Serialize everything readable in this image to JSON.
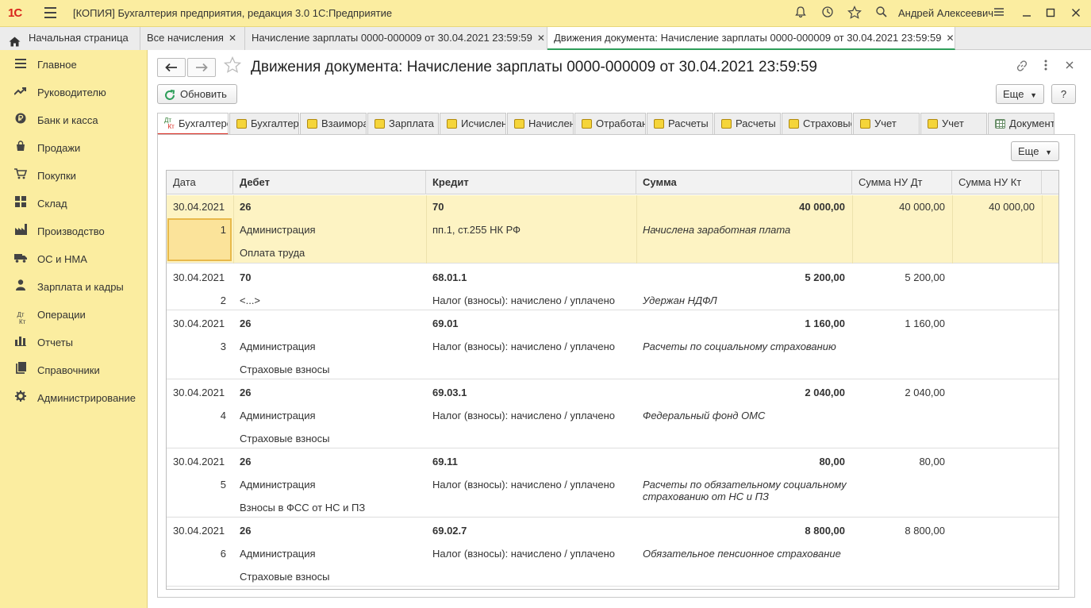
{
  "titlebar": {
    "logo": "1С",
    "title": "[КОПИЯ] Бухгалтерия предприятия, редакция 3.0 1С:Предприятие",
    "user": "Андрей Алексеевич"
  },
  "tabs": [
    {
      "label": "Начальная страница"
    },
    {
      "label": "Все начисления"
    },
    {
      "label": "Начисление зарплаты 0000-000009 от 30.04.2021 23:59:59"
    },
    {
      "label": "Движения документа: Начисление зарплаты 0000-000009 от 30.04.2021 23:59:59"
    }
  ],
  "sidebar": {
    "items": [
      {
        "label": "Главное",
        "icon": "menu-icon"
      },
      {
        "label": "Руководителю",
        "icon": "trend-icon"
      },
      {
        "label": "Банк и касса",
        "icon": "ruble-icon"
      },
      {
        "label": "Продажи",
        "icon": "bag-icon"
      },
      {
        "label": "Покупки",
        "icon": "cart-icon"
      },
      {
        "label": "Склад",
        "icon": "warehouse-icon"
      },
      {
        "label": "Производство",
        "icon": "factory-icon"
      },
      {
        "label": "ОС и НМА",
        "icon": "truck-icon"
      },
      {
        "label": "Зарплата и кадры",
        "icon": "person-icon"
      },
      {
        "label": "Операции",
        "icon": "dtkt-icon"
      },
      {
        "label": "Отчеты",
        "icon": "bar-chart-icon"
      },
      {
        "label": "Справочники",
        "icon": "book-icon"
      },
      {
        "label": "Администрирование",
        "icon": "gear-icon"
      }
    ]
  },
  "document": {
    "title": "Движения документа: Начисление зарплаты 0000-000009 от 30.04.2021 23:59:59",
    "refresh_label": "Обновить",
    "more_label": "Еще",
    "help_label": "?",
    "table_more_label": "Еще"
  },
  "subtabs": [
    {
      "label": "Бухгалтерский и налоговый учет"
    },
    {
      "label": "Бухгалтерский учет"
    },
    {
      "label": "Взаиморасчеты"
    },
    {
      "label": "Зарплата"
    },
    {
      "label": "Исчисленные налоги"
    },
    {
      "label": "Начисления"
    },
    {
      "label": "Отработанное время"
    },
    {
      "label": "Расчеты"
    },
    {
      "label": "Расчеты"
    },
    {
      "label": "Страховые взносы"
    },
    {
      "label": "Учет"
    },
    {
      "label": "Учет"
    },
    {
      "label": "Документ"
    }
  ],
  "table": {
    "headers": {
      "date": "Дата",
      "debit": "Дебет",
      "credit": "Кредит",
      "amount": "Сумма",
      "nu_dt": "Сумма НУ Дт",
      "nu_kt": "Сумма НУ Кт"
    },
    "rows": [
      {
        "date": "30.04.2021",
        "num": "1",
        "debit": "26",
        "debit_sub1": "Администрация",
        "debit_sub2": "Оплата труда",
        "credit": "70",
        "credit_sub1": "пп.1, ст.255 НК РФ",
        "amount": "40 000,00",
        "content": "Начислена заработная плата",
        "nu_dt": "40 000,00",
        "nu_kt": "40 000,00"
      },
      {
        "date": "30.04.2021",
        "num": "2",
        "debit": "70",
        "debit_sub1": "<...>",
        "debit_sub2": "",
        "credit": "68.01.1",
        "credit_sub1": "Налог (взносы): начислено / уплачено",
        "amount": "5 200,00",
        "content": "Удержан НДФЛ",
        "nu_dt": "5 200,00",
        "nu_kt": ""
      },
      {
        "date": "30.04.2021",
        "num": "3",
        "debit": "26",
        "debit_sub1": "Администрация",
        "debit_sub2": "Страховые взносы",
        "credit": "69.01",
        "credit_sub1": "Налог (взносы): начислено / уплачено",
        "amount": "1 160,00",
        "content": "Расчеты по социальному страхованию",
        "nu_dt": "1 160,00",
        "nu_kt": ""
      },
      {
        "date": "30.04.2021",
        "num": "4",
        "debit": "26",
        "debit_sub1": "Администрация",
        "debit_sub2": "Страховые взносы",
        "credit": "69.03.1",
        "credit_sub1": "Налог (взносы): начислено / уплачено",
        "amount": "2 040,00",
        "content": "Федеральный фонд ОМС",
        "nu_dt": "2 040,00",
        "nu_kt": ""
      },
      {
        "date": "30.04.2021",
        "num": "5",
        "debit": "26",
        "debit_sub1": "Администрация",
        "debit_sub2": "Взносы в ФСС от НС и ПЗ",
        "credit": "69.11",
        "credit_sub1": "Налог (взносы): начислено / уплачено",
        "amount": "80,00",
        "content": "Расчеты по обязательному социальному страхованию от НС и ПЗ",
        "nu_dt": "80,00",
        "nu_kt": ""
      },
      {
        "date": "30.04.2021",
        "num": "6",
        "debit": "26",
        "debit_sub1": "Администрация",
        "debit_sub2": "Страховые взносы",
        "credit": "69.02.7",
        "credit_sub1": "Налог (взносы): начислено / уплачено",
        "amount": "8 800,00",
        "content": "Обязательное пенсионное страхование",
        "nu_dt": "8 800,00",
        "nu_kt": ""
      }
    ]
  },
  "colors": {
    "accent_yellow": "#fbeda0",
    "active_tab_underline": "#2e9e5a",
    "selected_row": "#fdf3c3",
    "logo_red": "#d9261c"
  }
}
